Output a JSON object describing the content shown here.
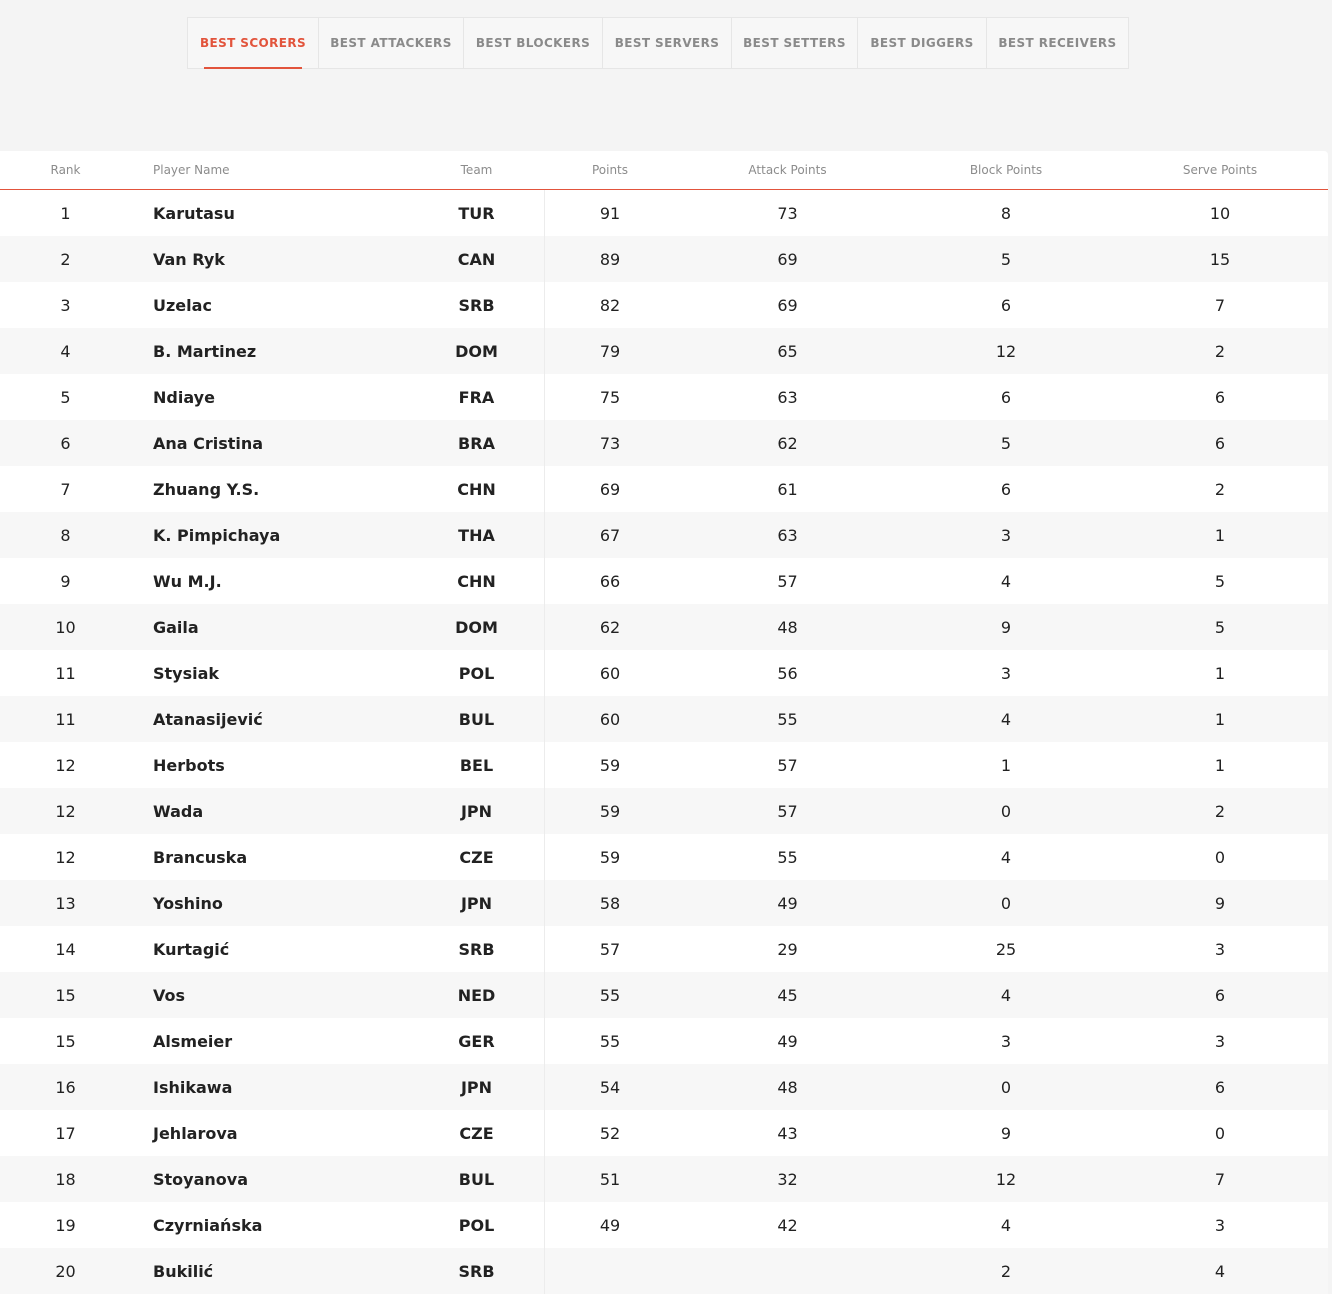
{
  "tabs": [
    {
      "label": "BEST SCORERS",
      "active": true
    },
    {
      "label": "BEST ATTACKERS",
      "active": false
    },
    {
      "label": "BEST BLOCKERS",
      "active": false
    },
    {
      "label": "BEST SERVERS",
      "active": false
    },
    {
      "label": "BEST SETTERS",
      "active": false
    },
    {
      "label": "BEST DIGGERS",
      "active": false
    },
    {
      "label": "BEST RECEIVERS",
      "active": false
    }
  ],
  "accent_color": "#e2543c",
  "table": {
    "headers": {
      "rank": "Rank",
      "player": "Player Name",
      "team": "Team",
      "points": "Points",
      "attack": "Attack Points",
      "block": "Block Points",
      "serve": "Serve Points"
    },
    "rows": [
      {
        "rank": "1",
        "player": "Karutasu",
        "team": "TUR",
        "points": "91",
        "attack": "73",
        "block": "8",
        "serve": "10"
      },
      {
        "rank": "2",
        "player": "Van Ryk",
        "team": "CAN",
        "points": "89",
        "attack": "69",
        "block": "5",
        "serve": "15"
      },
      {
        "rank": "3",
        "player": "Uzelac",
        "team": "SRB",
        "points": "82",
        "attack": "69",
        "block": "6",
        "serve": "7"
      },
      {
        "rank": "4",
        "player": "B. Martinez",
        "team": "DOM",
        "points": "79",
        "attack": "65",
        "block": "12",
        "serve": "2"
      },
      {
        "rank": "5",
        "player": "Ndiaye",
        "team": "FRA",
        "points": "75",
        "attack": "63",
        "block": "6",
        "serve": "6"
      },
      {
        "rank": "6",
        "player": "Ana Cristina",
        "team": "BRA",
        "points": "73",
        "attack": "62",
        "block": "5",
        "serve": "6"
      },
      {
        "rank": "7",
        "player": "Zhuang Y.S.",
        "team": "CHN",
        "points": "69",
        "attack": "61",
        "block": "6",
        "serve": "2"
      },
      {
        "rank": "8",
        "player": "K. Pimpichaya",
        "team": "THA",
        "points": "67",
        "attack": "63",
        "block": "3",
        "serve": "1"
      },
      {
        "rank": "9",
        "player": "Wu M.J.",
        "team": "CHN",
        "points": "66",
        "attack": "57",
        "block": "4",
        "serve": "5"
      },
      {
        "rank": "10",
        "player": "Gaila",
        "team": "DOM",
        "points": "62",
        "attack": "48",
        "block": "9",
        "serve": "5"
      },
      {
        "rank": "11",
        "player": "Stysiak",
        "team": "POL",
        "points": "60",
        "attack": "56",
        "block": "3",
        "serve": "1"
      },
      {
        "rank": "11",
        "player": "Atanasijević",
        "team": "BUL",
        "points": "60",
        "attack": "55",
        "block": "4",
        "serve": "1"
      },
      {
        "rank": "12",
        "player": "Herbots",
        "team": "BEL",
        "points": "59",
        "attack": "57",
        "block": "1",
        "serve": "1"
      },
      {
        "rank": "12",
        "player": "Wada",
        "team": "JPN",
        "points": "59",
        "attack": "57",
        "block": "0",
        "serve": "2"
      },
      {
        "rank": "12",
        "player": "Brancuska",
        "team": "CZE",
        "points": "59",
        "attack": "55",
        "block": "4",
        "serve": "0"
      },
      {
        "rank": "13",
        "player": "Yoshino",
        "team": "JPN",
        "points": "58",
        "attack": "49",
        "block": "0",
        "serve": "9"
      },
      {
        "rank": "14",
        "player": "Kurtagić",
        "team": "SRB",
        "points": "57",
        "attack": "29",
        "block": "25",
        "serve": "3"
      },
      {
        "rank": "15",
        "player": "Vos",
        "team": "NED",
        "points": "55",
        "attack": "45",
        "block": "4",
        "serve": "6"
      },
      {
        "rank": "15",
        "player": "Alsmeier",
        "team": "GER",
        "points": "55",
        "attack": "49",
        "block": "3",
        "serve": "3"
      },
      {
        "rank": "16",
        "player": "Ishikawa",
        "team": "JPN",
        "points": "54",
        "attack": "48",
        "block": "0",
        "serve": "6"
      },
      {
        "rank": "17",
        "player": "Jehlarova",
        "team": "CZE",
        "points": "52",
        "attack": "43",
        "block": "9",
        "serve": "0"
      },
      {
        "rank": "18",
        "player": "Stoyanova",
        "team": "BUL",
        "points": "51",
        "attack": "32",
        "block": "12",
        "serve": "7"
      },
      {
        "rank": "19",
        "player": "Czyrniańska",
        "team": "POL",
        "points": "49",
        "attack": "42",
        "block": "4",
        "serve": "3"
      },
      {
        "rank": "20",
        "player": "Bukilić",
        "team": "SRB",
        "points": "",
        "attack": "",
        "block": "2",
        "serve": "4"
      }
    ]
  }
}
